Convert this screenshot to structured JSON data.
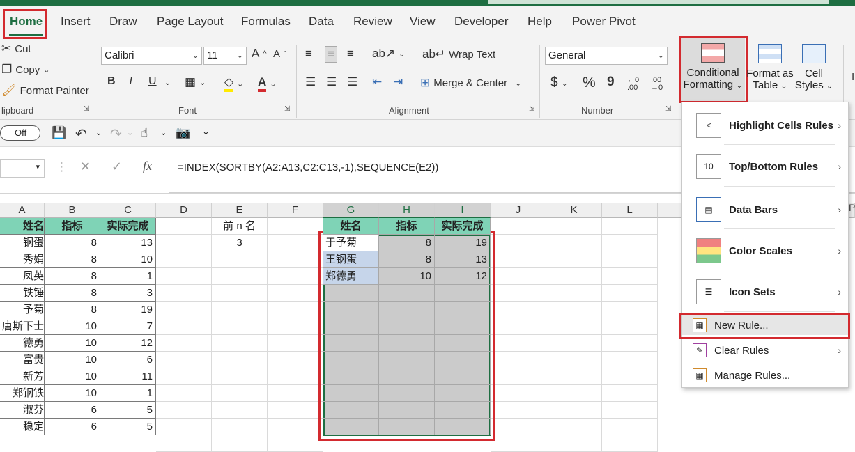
{
  "tabs": [
    "Home",
    "Insert",
    "Draw",
    "Page Layout",
    "Formulas",
    "Data",
    "Review",
    "View",
    "Developer",
    "Help",
    "Power Pivot"
  ],
  "clipboard": {
    "cut": "Cut",
    "copy": "Copy",
    "format_painter": "Format Painter",
    "label": "lipboard"
  },
  "font": {
    "name": "Calibri",
    "size": "11",
    "label": "Font",
    "bold": "B",
    "italic": "I",
    "underline": "U"
  },
  "alignment": {
    "wrap": "Wrap Text",
    "merge": "Merge & Center",
    "label": "Alignment"
  },
  "number": {
    "format": "General",
    "label": "Number",
    "currency": "$",
    "percent": "%",
    "comma": "9",
    "inc_decimal": "←0 .00",
    "dec_decimal": ".00 →0"
  },
  "styles": {
    "conditional": "Conditional",
    "formatting": "Formatting",
    "format_as": "Format as",
    "table": "Table",
    "cell": "Cell",
    "styles": "Styles"
  },
  "qat": {
    "autosave": "Off"
  },
  "formula_bar": {
    "cancel": "✕",
    "enter": "✓",
    "fx": "fx",
    "formula": "=INDEX(SORTBY(A2:A13,C2:C13,-1),SEQUENCE(E2))"
  },
  "columns": [
    "A",
    "B",
    "C",
    "D",
    "E",
    "F",
    "G",
    "H",
    "I",
    "J",
    "K",
    "L"
  ],
  "table_headers": {
    "a": "姓名",
    "b": "指标",
    "c": "实际完成"
  },
  "rows": [
    {
      "a": "钢蛋",
      "b": 8,
      "c": 13
    },
    {
      "a": "秀娟",
      "b": 8,
      "c": 10
    },
    {
      "a": "凤英",
      "b": 8,
      "c": 1
    },
    {
      "a": "铁锤",
      "b": 8,
      "c": 3
    },
    {
      "a": "予菊",
      "b": 8,
      "c": 19
    },
    {
      "a": "唐斯下士",
      "b": 10,
      "c": 7
    },
    {
      "a": "德勇",
      "b": 10,
      "c": 12
    },
    {
      "a": "富贵",
      "b": 10,
      "c": 6
    },
    {
      "a": "新芳",
      "b": 10,
      "c": 11
    },
    {
      "a": "郑钢铁",
      "b": 10,
      "c": 1
    },
    {
      "a": "淑芬",
      "b": 6,
      "c": 5
    },
    {
      "a": "稳定",
      "b": 6,
      "c": 5
    }
  ],
  "e": {
    "header": "前 n 名",
    "value": "3"
  },
  "result_headers": {
    "g": "姓名",
    "h": "指标",
    "i": "实际完成"
  },
  "result_rows": [
    {
      "g": "于予菊",
      "h": 8,
      "i": 19
    },
    {
      "g": "王钢蛋",
      "h": 8,
      "i": 13
    },
    {
      "g": "郑德勇",
      "h": 10,
      "i": 12
    }
  ],
  "menu": {
    "highlight": "Highlight Cells Rules",
    "topbottom": "Top/Bottom Rules",
    "databars": "Data Bars",
    "colorscales": "Color Scales",
    "iconsets": "Icon Sets",
    "newrule": "New Rule...",
    "clearrules": "Clear Rules",
    "managerules": "Manage Rules..."
  },
  "colors": {
    "excel_green": "#1e6e42",
    "header_fill": "#7fd3b6",
    "highlight_red": "#d32a2f",
    "selection_gray": "#cbcbcb"
  }
}
